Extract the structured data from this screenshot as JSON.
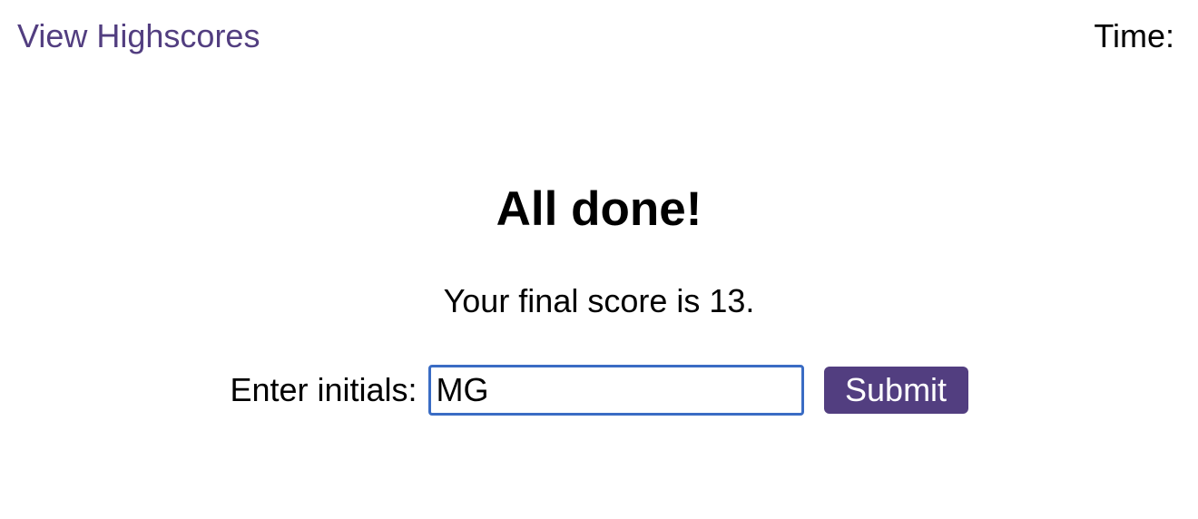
{
  "header": {
    "highscores_link": "View Highscores",
    "time_label": "Time:",
    "time_value": ""
  },
  "main": {
    "title": "All done!",
    "score_text": "Your final score is 13."
  },
  "form": {
    "label": "Enter initials:",
    "initials_value": "MG",
    "submit_label": "Submit"
  },
  "colors": {
    "accent": "#523e80",
    "input_focus_border": "#3a6cc4"
  }
}
